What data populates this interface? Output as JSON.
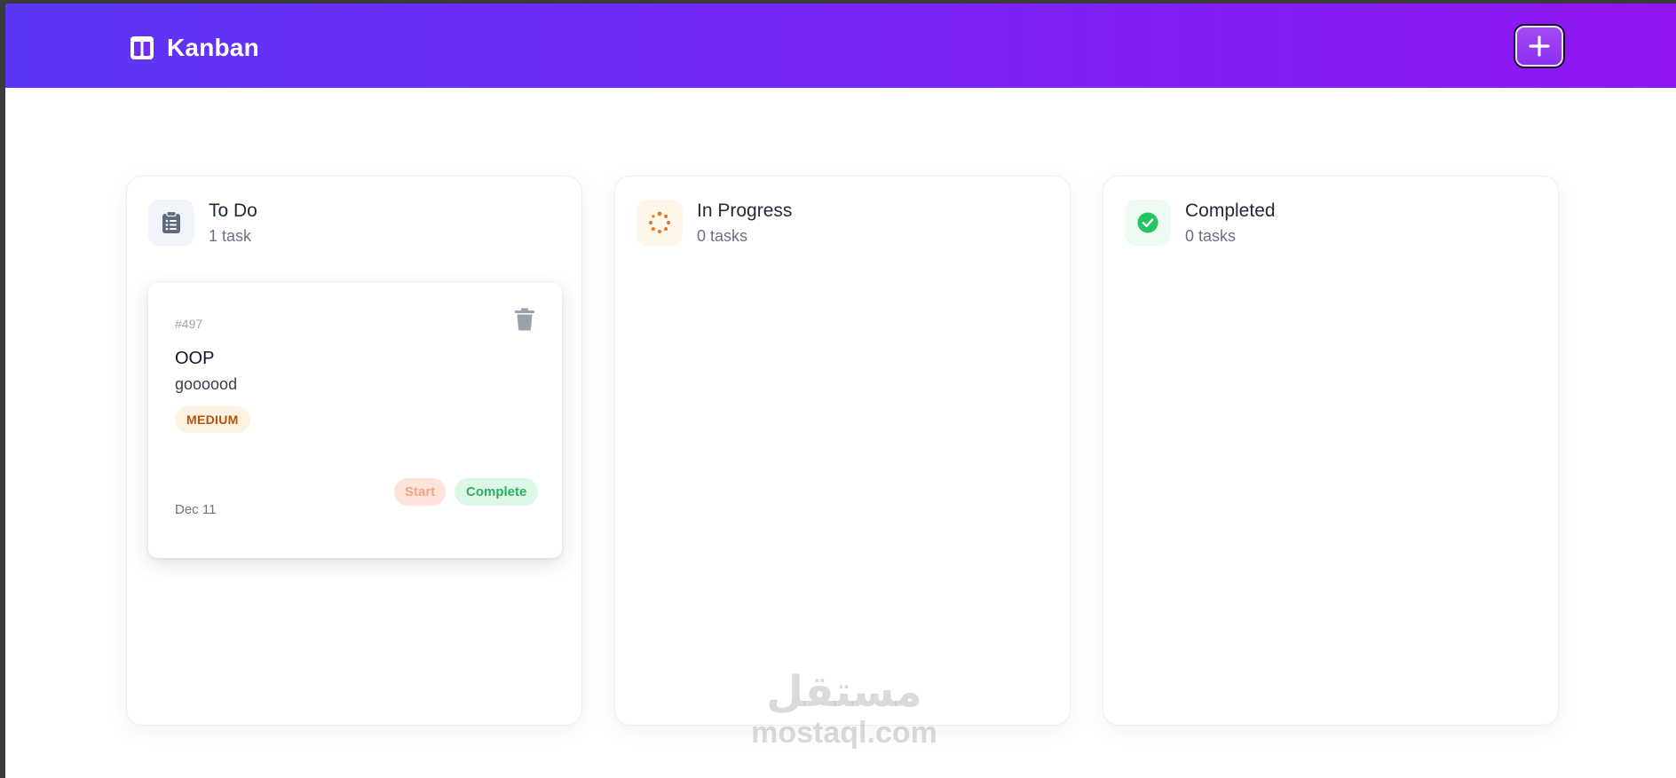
{
  "header": {
    "brand": "Kanban",
    "brand_icon": "columns-icon",
    "add_icon": "plus-icon",
    "gradient_start": "#5b36f7",
    "gradient_end": "#9216f4"
  },
  "columns": [
    {
      "title": "To Do",
      "count": "1 task",
      "icon": "clipboard-list-icon",
      "icon_color": "#5f6b7c",
      "icon_bg": "#f1f4f8",
      "cards": [
        {
          "id": "#497",
          "title": "OOP",
          "description": "goooood",
          "priority": "MEDIUM",
          "date": "Dec 11",
          "start_label": "Start",
          "complete_label": "Complete"
        }
      ]
    },
    {
      "title": "In Progress",
      "count": "0 tasks",
      "icon": "spinner-icon",
      "icon_color": "#e07a2c",
      "icon_bg": "#fff7ea",
      "cards": []
    },
    {
      "title": "Completed",
      "count": "0 tasks",
      "icon": "check-circle-icon",
      "icon_color": "#22c55e",
      "icon_bg": "#eefbf2",
      "cards": []
    }
  ],
  "watermark": {
    "arabic": "مستقل",
    "latin": "mostaql.com"
  }
}
